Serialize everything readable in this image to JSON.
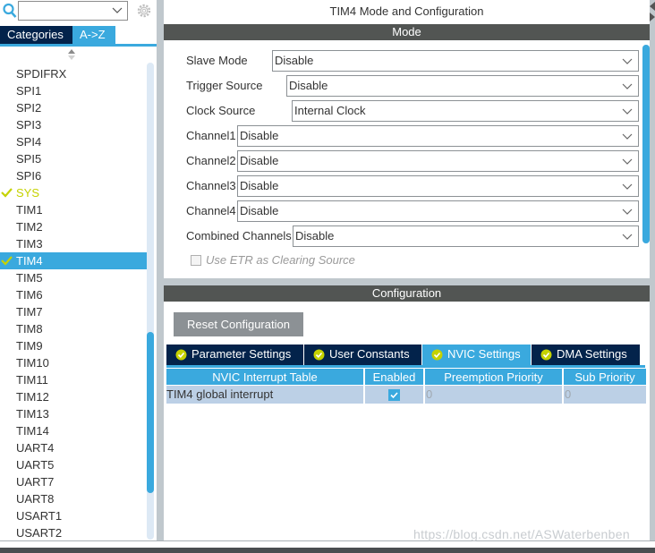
{
  "sidebar": {
    "search": {
      "value": "",
      "placeholder": ""
    },
    "tabs": [
      {
        "label": "Categories",
        "active": false
      },
      {
        "label": "A->Z",
        "active": true
      }
    ],
    "items": [
      {
        "label": "SPDIFRX",
        "status": ""
      },
      {
        "label": "SPI1",
        "status": ""
      },
      {
        "label": "SPI2",
        "status": ""
      },
      {
        "label": "SPI3",
        "status": ""
      },
      {
        "label": "SPI4",
        "status": ""
      },
      {
        "label": "SPI5",
        "status": ""
      },
      {
        "label": "SPI6",
        "status": ""
      },
      {
        "label": "SYS",
        "status": "ok"
      },
      {
        "label": "TIM1",
        "status": ""
      },
      {
        "label": "TIM2",
        "status": ""
      },
      {
        "label": "TIM3",
        "status": ""
      },
      {
        "label": "TIM4",
        "status": "ok-selected"
      },
      {
        "label": "TIM5",
        "status": ""
      },
      {
        "label": "TIM6",
        "status": ""
      },
      {
        "label": "TIM7",
        "status": ""
      },
      {
        "label": "TIM8",
        "status": ""
      },
      {
        "label": "TIM9",
        "status": ""
      },
      {
        "label": "TIM10",
        "status": ""
      },
      {
        "label": "TIM11",
        "status": ""
      },
      {
        "label": "TIM12",
        "status": ""
      },
      {
        "label": "TIM13",
        "status": ""
      },
      {
        "label": "TIM14",
        "status": ""
      },
      {
        "label": "UART4",
        "status": ""
      },
      {
        "label": "UART5",
        "status": ""
      },
      {
        "label": "UART7",
        "status": ""
      },
      {
        "label": "UART8",
        "status": ""
      },
      {
        "label": "USART1",
        "status": ""
      },
      {
        "label": "USART2",
        "status": ""
      }
    ]
  },
  "main": {
    "title": "TIM4 Mode and Configuration",
    "mode": {
      "header": "Mode",
      "fields": [
        {
          "label": "Slave Mode",
          "value": "Disable"
        },
        {
          "label": "Trigger Source",
          "value": "Disable"
        },
        {
          "label": "Clock Source",
          "value": "Internal Clock"
        },
        {
          "label": "Channel1",
          "value": "Disable"
        },
        {
          "label": "Channel2",
          "value": "Disable"
        },
        {
          "label": "Channel3",
          "value": "Disable"
        },
        {
          "label": "Channel4",
          "value": "Disable"
        },
        {
          "label": "Combined Channels",
          "value": "Disable"
        }
      ],
      "etr_label": "Use ETR as Clearing Source",
      "etr_checked": false
    },
    "configuration": {
      "header": "Configuration",
      "reset_label": "Reset Configuration",
      "tabs": [
        {
          "label": "Parameter Settings",
          "active": false
        },
        {
          "label": "User Constants",
          "active": false
        },
        {
          "label": "NVIC Settings",
          "active": true
        },
        {
          "label": "DMA Settings",
          "active": false
        }
      ],
      "table": {
        "columns": [
          "NVIC Interrupt Table",
          "Enabled",
          "Preemption Priority",
          "Sub Priority"
        ],
        "rows": [
          {
            "name": "TIM4 global interrupt",
            "enabled": true,
            "preemption": "0",
            "sub": "0"
          }
        ]
      }
    }
  },
  "watermark": "https://blog.csdn.net/ASWaterbenben",
  "colors": {
    "accent": "#3aa9de",
    "navy": "#03234b",
    "header_bar": "#525553",
    "ok_green": "#c5d200"
  }
}
